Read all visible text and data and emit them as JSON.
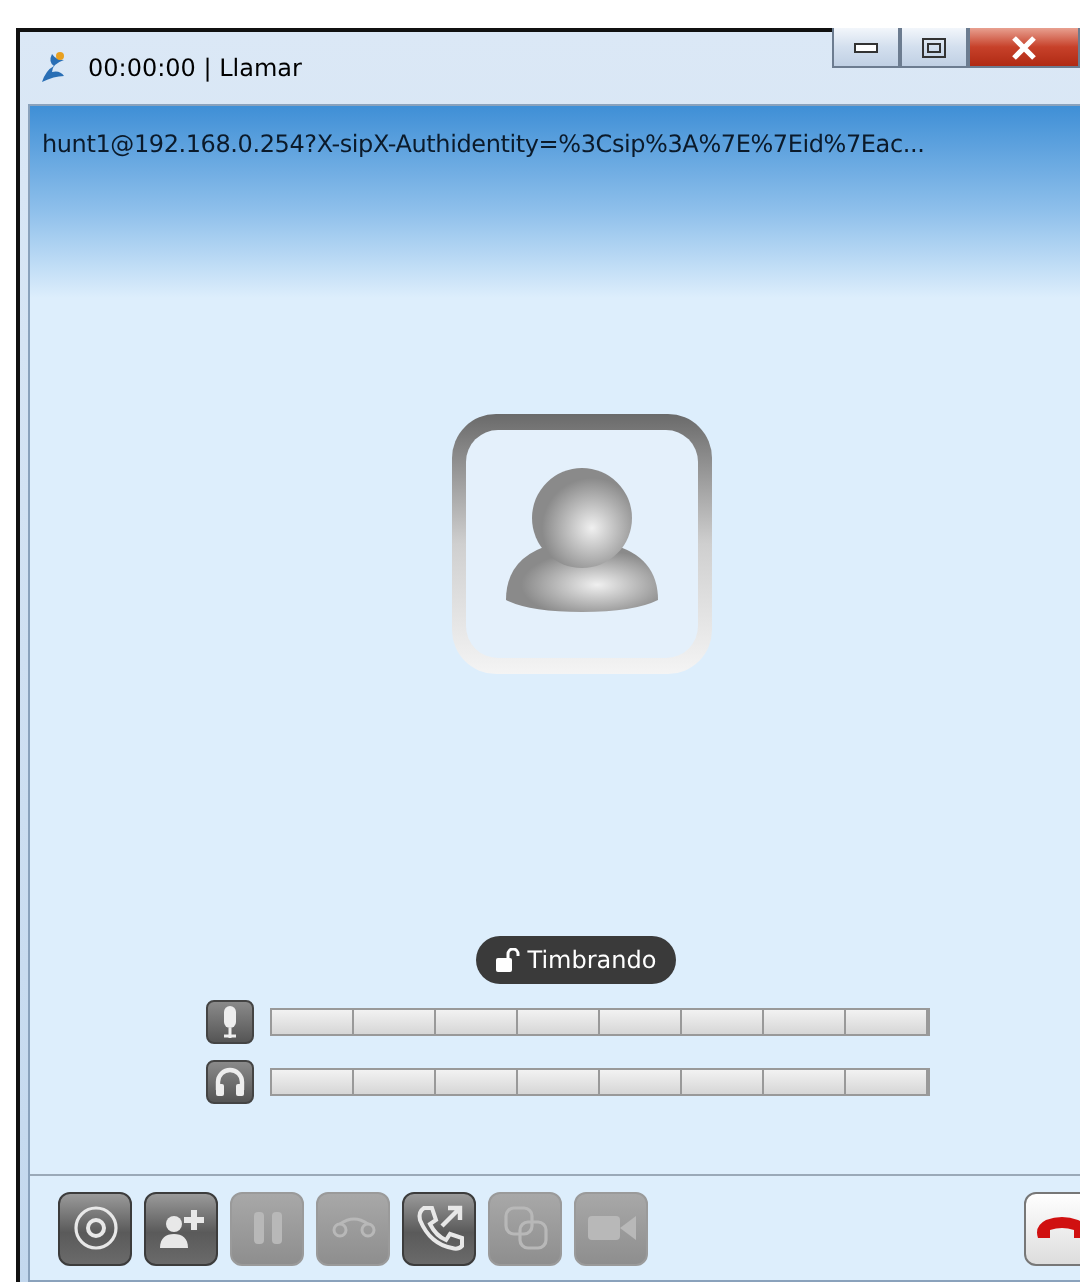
{
  "window": {
    "title": "00:00:00 | Llamar"
  },
  "header": {
    "address": "hunt1@192.168.0.254?X-sipX-Authidentity=%3Csip%3A%7E%7Eid%7Eac..."
  },
  "status": {
    "label": "Timbrando"
  },
  "meters": [
    {
      "kind": "microphone",
      "level": 0
    },
    {
      "kind": "headphones",
      "level": 0
    }
  ],
  "toolbar": [
    {
      "kind": "dialpad",
      "disabled": false
    },
    {
      "kind": "add-contact",
      "disabled": false
    },
    {
      "kind": "hold",
      "disabled": true
    },
    {
      "kind": "voicemail",
      "disabled": true
    },
    {
      "kind": "transfer",
      "disabled": false
    },
    {
      "kind": "conference",
      "disabled": true
    },
    {
      "kind": "video",
      "disabled": true
    }
  ],
  "hangup": {
    "disabled": false
  }
}
